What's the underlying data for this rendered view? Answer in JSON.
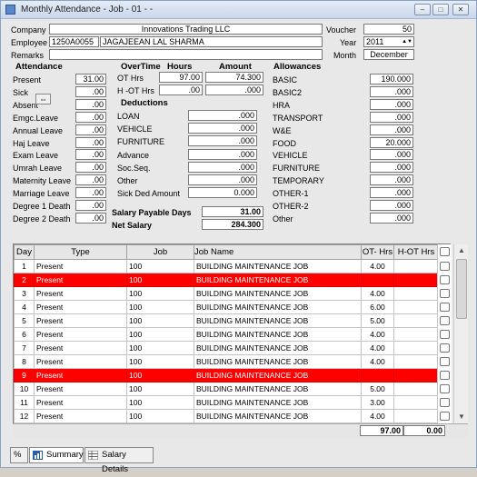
{
  "window": {
    "title": "Monthly Attendance - Job - 01 - -",
    "btn_min": "–",
    "btn_max": "□",
    "btn_close": "✕"
  },
  "header": {
    "company_label": "Company",
    "company_value": "Innovations Trading LLC",
    "employee_label": "Employee",
    "employee_code": "1250A0055",
    "employee_name": "JAGAJEEAN LAL SHARMA",
    "remarks_label": "Remarks",
    "remarks_value": "",
    "voucher_label": "Voucher",
    "voucher_value": "50",
    "year_label": "Year",
    "year_value": "2011",
    "month_label": "Month",
    "month_value": "December"
  },
  "attendance": {
    "title": "Attendance",
    "items": [
      {
        "label": "Present",
        "value": "31.00"
      },
      {
        "label": "Sick",
        "value": ".00"
      },
      {
        "label": "Absent",
        "value": ".00"
      },
      {
        "label": "Emgc.Leave",
        "value": ".00"
      },
      {
        "label": "Annual Leave",
        "value": ".00"
      },
      {
        "label": "Haj Leave",
        "value": ".00"
      },
      {
        "label": "Exam Leave",
        "value": ".00"
      },
      {
        "label": "Umrah Leave",
        "value": ".00"
      },
      {
        "label": "Maternity Leave",
        "value": ".00"
      },
      {
        "label": "Marriage Leave",
        "value": ".00"
      },
      {
        "label": "Degree 1 Death",
        "value": ".00"
      },
      {
        "label": "Degree 2 Death",
        "value": ".00"
      }
    ]
  },
  "overtime": {
    "title": "OverTime",
    "hours_label": "Hours",
    "amount_label": "Amount",
    "ot_label": "OT Hrs",
    "ot_hours": "97.00",
    "ot_amount": "74.300",
    "hot_label": "H -OT Hrs",
    "hot_hours": ".00",
    "hot_amount": ".000"
  },
  "deductions": {
    "title": "Deductions",
    "items": [
      {
        "label": "LOAN",
        "value": ".000"
      },
      {
        "label": "VEHICLE",
        "value": ".000"
      },
      {
        "label": "FURNITURE",
        "value": ".000"
      },
      {
        "label": "Advance",
        "value": ".000"
      },
      {
        "label": "Soc.Seq.",
        "value": ".000"
      },
      {
        "label": "Other",
        "value": ".000"
      },
      {
        "label": "Sick Ded Amount",
        "value": "0.000"
      }
    ]
  },
  "salary": {
    "payable_days_label": "Salary Payable Days",
    "payable_days_value": "31.00",
    "net_label": "Net Salary",
    "net_value": "284.300"
  },
  "allowances": {
    "title": "Allowances",
    "items": [
      {
        "label": "BASIC",
        "value": "190.000"
      },
      {
        "label": "BASIC2",
        "value": ".000"
      },
      {
        "label": "HRA",
        "value": ".000"
      },
      {
        "label": "TRANSPORT",
        "value": ".000"
      },
      {
        "label": "W&E",
        "value": ".000"
      },
      {
        "label": "FOOD",
        "value": "20.000"
      },
      {
        "label": "VEHICLE",
        "value": ".000"
      },
      {
        "label": "FURNITURE",
        "value": ".000"
      },
      {
        "label": "TEMPORARY",
        "value": ".000"
      },
      {
        "label": "OTHER-1",
        "value": ".000"
      },
      {
        "label": "OTHER-2",
        "value": ".000"
      },
      {
        "label": "Other",
        "value": ".000"
      }
    ]
  },
  "grid": {
    "columns": [
      "Day",
      "Type",
      "Job",
      "Job Name",
      "OT- Hrs",
      "H-OT Hrs"
    ],
    "rows": [
      {
        "day": "1",
        "type": "Present",
        "job": "100",
        "job_name": "BUILDING MAINTENANCE JOB",
        "ot": "4.00",
        "hot": "",
        "highlight": false
      },
      {
        "day": "2",
        "type": "Present",
        "job": "100",
        "job_name": "BUILDING MAINTENANCE JOB",
        "ot": "",
        "hot": "",
        "highlight": true
      },
      {
        "day": "3",
        "type": "Present",
        "job": "100",
        "job_name": "BUILDING MAINTENANCE JOB",
        "ot": "4.00",
        "hot": "",
        "highlight": false
      },
      {
        "day": "4",
        "type": "Present",
        "job": "100",
        "job_name": "BUILDING MAINTENANCE JOB",
        "ot": "6.00",
        "hot": "",
        "highlight": false
      },
      {
        "day": "5",
        "type": "Present",
        "job": "100",
        "job_name": "BUILDING MAINTENANCE JOB",
        "ot": "5.00",
        "hot": "",
        "highlight": false
      },
      {
        "day": "6",
        "type": "Present",
        "job": "100",
        "job_name": "BUILDING MAINTENANCE JOB",
        "ot": "4.00",
        "hot": "",
        "highlight": false
      },
      {
        "day": "7",
        "type": "Present",
        "job": "100",
        "job_name": "BUILDING MAINTENANCE JOB",
        "ot": "4.00",
        "hot": "",
        "highlight": false
      },
      {
        "day": "8",
        "type": "Present",
        "job": "100",
        "job_name": "BUILDING MAINTENANCE JOB",
        "ot": "4.00",
        "hot": "",
        "highlight": false
      },
      {
        "day": "9",
        "type": "Present",
        "job": "100",
        "job_name": "BUILDING MAINTENANCE JOB",
        "ot": "",
        "hot": "",
        "highlight": true
      },
      {
        "day": "10",
        "type": "Present",
        "job": "100",
        "job_name": "BUILDING MAINTENANCE JOB",
        "ot": "5.00",
        "hot": "",
        "highlight": false
      },
      {
        "day": "11",
        "type": "Present",
        "job": "100",
        "job_name": "BUILDING MAINTENANCE JOB",
        "ot": "3.00",
        "hot": "",
        "highlight": false
      },
      {
        "day": "12",
        "type": "Present",
        "job": "100",
        "job_name": "BUILDING MAINTENANCE JOB",
        "ot": "4.00",
        "hot": "",
        "highlight": false
      }
    ],
    "total_ot": "97.00",
    "total_hot": "0.00"
  },
  "tabs": [
    {
      "label": ""
    },
    {
      "label": "Summary"
    },
    {
      "label": "Salary Details"
    }
  ],
  "colors": {
    "highlight_row": "#ff0000"
  }
}
